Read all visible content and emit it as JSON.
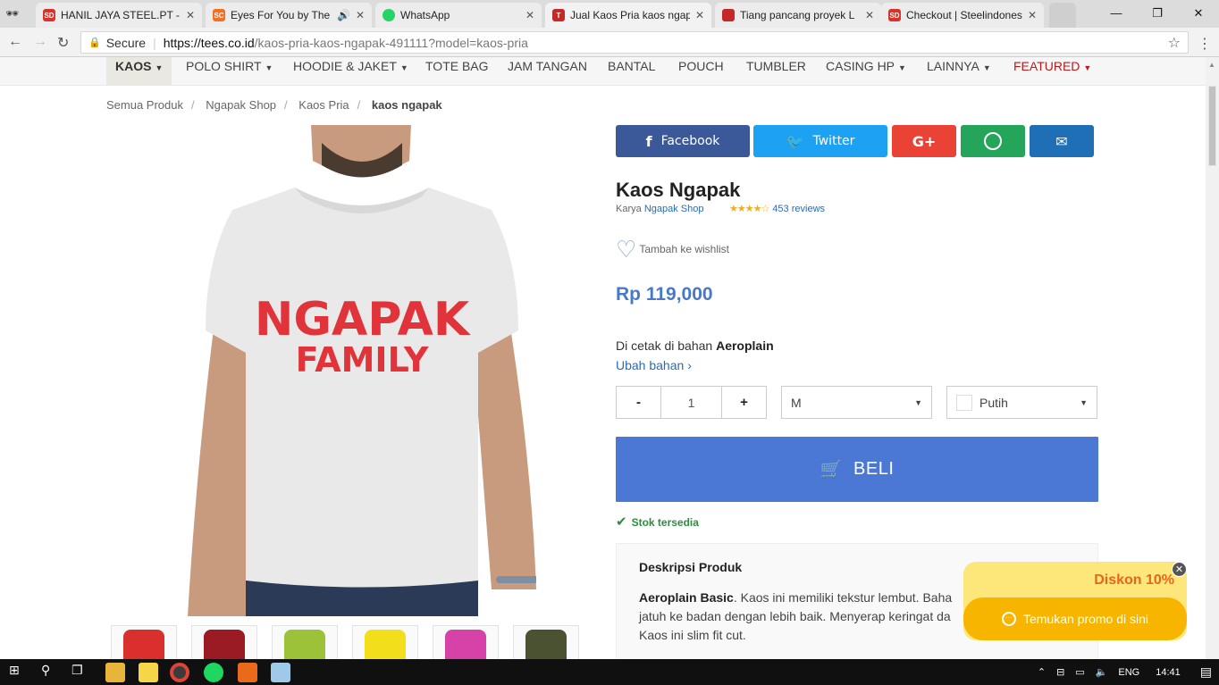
{
  "browser": {
    "tabs": [
      {
        "title": "HANIL JAYA STEEL.PT - S",
        "favicon": "SD"
      },
      {
        "title": "Eyes For You by The A",
        "favicon": "SC",
        "audio": true
      },
      {
        "title": "WhatsApp",
        "favicon": "WA"
      },
      {
        "title": "Jual Kaos Pria kaos ngap",
        "favicon": "T",
        "active": true
      },
      {
        "title": "Tiang pancang proyek L",
        "favicon": "B"
      },
      {
        "title": "Checkout | Steelindones",
        "favicon": "SD"
      }
    ],
    "secure_label": "Secure",
    "url_host": "https://tees.co.id",
    "url_path": "/kaos-pria-kaos-ngapak-491111?model=kaos-pria"
  },
  "nav": {
    "items": [
      {
        "label": "KAOS",
        "caret": true,
        "active": true
      },
      {
        "label": "POLO SHIRT",
        "caret": true
      },
      {
        "label": "HOODIE & JAKET",
        "caret": true
      },
      {
        "label": "TOTE BAG"
      },
      {
        "label": "JAM TANGAN"
      },
      {
        "label": "BANTAL"
      },
      {
        "label": "POUCH"
      },
      {
        "label": "TUMBLER"
      },
      {
        "label": "CASING HP",
        "caret": true
      },
      {
        "label": "LAINNYA",
        "caret": true
      },
      {
        "label": "FEATURED",
        "caret": true,
        "featured": true
      }
    ]
  },
  "breadcrumb": {
    "items": [
      "Semua Produk",
      "Ngapak Shop",
      "Kaos Pria"
    ],
    "current": "kaos ngapak"
  },
  "product": {
    "print_line1": "NGAPAK",
    "print_line2": "FAMILY",
    "title": "Kaos Ngapak",
    "by_label": "Karya",
    "shop": "Ngapak Shop",
    "stars": "★★★★☆",
    "reviews": "453 reviews",
    "wishlist": "Tambah ke wishlist",
    "price": "Rp 119,000",
    "material_prefix": "Di cetak di bahan",
    "material": "Aeroplain",
    "change_material": "Ubah bahan",
    "qty_minus": "-",
    "qty_value": "1",
    "qty_plus": "+",
    "size": "M",
    "color": "Putih",
    "buy": "BELI",
    "stock": "Stok tersedia",
    "desc_title": "Deskripsi Produk",
    "desc_bold": "Aeroplain Basic",
    "desc_text": ". Kaos ini memiliki tekstur lembut. Baha",
    "desc_text2": "jatuh ke badan dengan lebih baik. Menyerap keringat da",
    "desc_text3": "Kaos ini slim fit cut.",
    "thumb_colors": [
      "#d9302e",
      "#9b1b25",
      "#9cc23a",
      "#f2de1a",
      "#d642a8",
      "#4a5232"
    ]
  },
  "share": {
    "facebook": "Facebook",
    "twitter": "Twitter",
    "google": "G+",
    "colors": {
      "facebook": "#3b5998",
      "twitter": "#1da1f2",
      "google": "#ea4335",
      "whatsapp": "#25a55a",
      "email": "#1e6fb5"
    }
  },
  "promo": {
    "discount": "Diskon 10%",
    "button": "Temukan promo di sini"
  },
  "taskbar": {
    "lang": "ENG",
    "time": "14:41"
  }
}
